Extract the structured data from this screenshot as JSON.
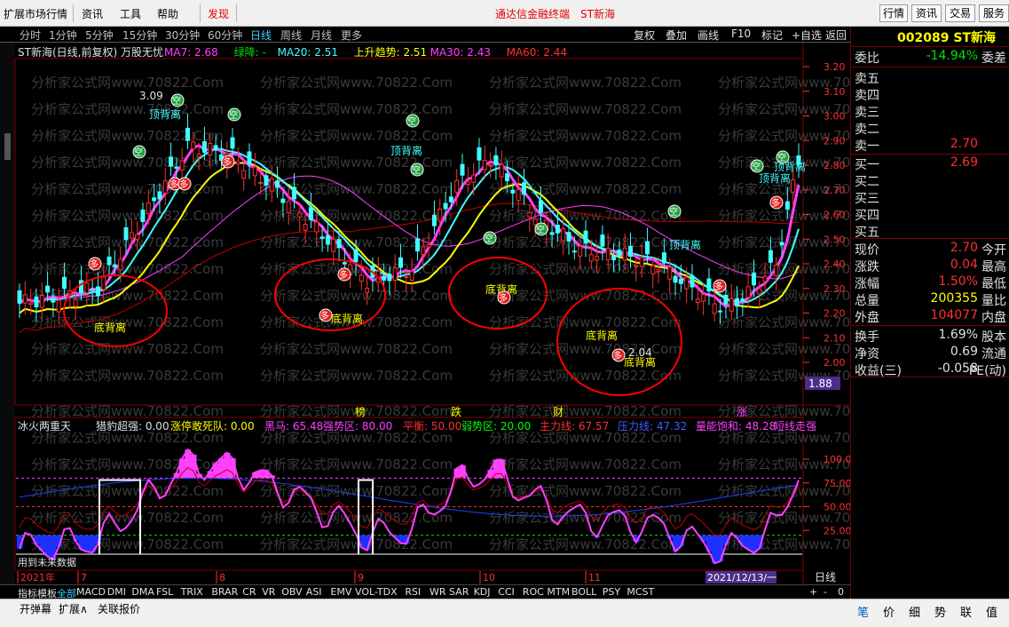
{
  "menu": {
    "items": [
      "扩展市场行情",
      "资讯",
      "工具",
      "帮助",
      "发现"
    ],
    "center_text": "通达信金融终端",
    "center_stock": "ST新海",
    "right_buttons": [
      "行情",
      "资讯",
      "交易",
      "服务"
    ]
  },
  "period_bar": {
    "items": [
      "分时",
      "1分钟",
      "5分钟",
      "15分钟",
      "30分钟",
      "60分钟",
      "日线",
      "周线",
      "月线",
      "更多"
    ],
    "active": "日线",
    "tools": [
      "复权",
      "叠加",
      "画线",
      "F10",
      "标记",
      "+自选",
      "返回"
    ]
  },
  "main_chart": {
    "legend_title": "ST新海(日线,前复权) 万股无忧",
    "legend": [
      {
        "label": "MA7: 2.68",
        "color": "#ff40ff"
      },
      {
        "label": "绿降: -",
        "color": "#00e000"
      },
      {
        "label": "MA20: 2.51",
        "color": "#40ffff"
      },
      {
        "label": "上升趋势: 2.51",
        "color": "#ffff00"
      },
      {
        "label": "MA30: 2.43",
        "color": "#ff40ff"
      },
      {
        "label": "MA60: 2.44",
        "color": "#ff3030"
      }
    ],
    "price_ticks": [
      "3.20",
      "3.10",
      "3.00",
      "2.90",
      "2.80",
      "2.70",
      "2.60",
      "2.50",
      "2.40",
      "2.30",
      "2.20",
      "2.10",
      "2.00"
    ],
    "current_price_tag": "1.88",
    "high_label": "3.09",
    "low_label": "2.04",
    "watermark": "分析家公式网www.70822.Com",
    "annotations": {
      "top_divergence": "顶背离",
      "bottom_divergence": "底背离",
      "duo": "多",
      "kong": "空"
    }
  },
  "indicator": {
    "legend": [
      {
        "label": "冰火两重天",
        "color": "#e0e0e0"
      },
      {
        "label": "猎豹超强: 0.00",
        "color": "#e0e0e0"
      },
      {
        "label": "涨停敢死队: 0.00",
        "color": "#ffff00"
      },
      {
        "label": "黑马: 65.48",
        "color": "#ff40ff"
      },
      {
        "label": "强势区: 80.00",
        "color": "#ff40ff"
      },
      {
        "label": "平衡: 50.00",
        "color": "#ff3030"
      },
      {
        "label": "弱势区: 20.00",
        "color": "#00ff00"
      },
      {
        "label": "主力线: 67.57",
        "color": "#ff3030"
      },
      {
        "label": "压力线: 47.32",
        "color": "#4060ff"
      },
      {
        "label": "量能饱和: 48.28",
        "color": "#ff40ff"
      },
      {
        "label": "短线走强",
        "color": "#ff40ff"
      }
    ],
    "badges": [
      "榜",
      "跌",
      "财",
      "涨"
    ],
    "ticks": [
      "100.0",
      "75.00",
      "50.00",
      "25.00"
    ],
    "future_note": "用到未来数据"
  },
  "date_axis": {
    "labels": [
      "2021年",
      "7",
      "8",
      "9",
      "10",
      "11"
    ],
    "cursor_date": "2021/12/13/一",
    "period_label": "日线"
  },
  "indicator_tabs": {
    "items": [
      "指标",
      "模板",
      "全部",
      "MACD",
      "DMI",
      "DMA",
      "FSL",
      "TRIX",
      "BRAR",
      "CR",
      "VR",
      "OBV",
      "ASI",
      "EMV",
      "VOL-TDX",
      "RSI",
      "WR",
      "SAR",
      "KDJ",
      "CCI",
      "ROC",
      "MTM",
      "BOLL",
      "PSY",
      "MCST"
    ],
    "active": "全部",
    "controls": [
      "+",
      "-",
      "0"
    ]
  },
  "status_bar": {
    "items": [
      "开弹幕",
      "扩展∧",
      "关联报价"
    ]
  },
  "quote_panel": {
    "code_name": "002089 ST新海",
    "weibi_label": "委比",
    "weibi_value": "-14.94%",
    "weicha_label": "委差",
    "sells": [
      {
        "label": "卖五",
        "price": ""
      },
      {
        "label": "卖四",
        "price": ""
      },
      {
        "label": "卖三",
        "price": ""
      },
      {
        "label": "卖二",
        "price": ""
      },
      {
        "label": "卖一",
        "price": "2.70"
      }
    ],
    "buys": [
      {
        "label": "买一",
        "price": "2.69"
      },
      {
        "label": "买二",
        "price": ""
      },
      {
        "label": "买三",
        "price": ""
      },
      {
        "label": "买四",
        "price": ""
      },
      {
        "label": "买五",
        "price": ""
      }
    ],
    "stats": [
      {
        "label": "现价",
        "value": "2.70",
        "label2": "今开",
        "color": "#ff3030"
      },
      {
        "label": "涨跌",
        "value": "0.04",
        "label2": "最高",
        "color": "#ff3030"
      },
      {
        "label": "涨幅",
        "value": "1.50%",
        "label2": "最低",
        "color": "#ff3030"
      },
      {
        "label": "总量",
        "value": "200355",
        "label2": "量比",
        "color": "#ffff00"
      },
      {
        "label": "外盘",
        "value": "104077",
        "label2": "内盘",
        "color": "#ff3030"
      }
    ],
    "stats2": [
      {
        "label": "换手",
        "value": "1.69%",
        "label2": "股本"
      },
      {
        "label": "净资",
        "value": "0.69",
        "label2": "流通"
      },
      {
        "label": "收益(三)",
        "value": "-0.058",
        "label2": "PE(动)"
      }
    ],
    "bottom_tabs": [
      "笔",
      "价",
      "细",
      "势",
      "联",
      "值"
    ]
  },
  "colors": {
    "up": "#ff3030",
    "down": "#40ffff",
    "ma7": "#ff40ff",
    "ma20": "#40ffff",
    "trend": "#ffff00",
    "ma60": "#c00000",
    "green": "#00e000",
    "circle": "#ff0000"
  }
}
